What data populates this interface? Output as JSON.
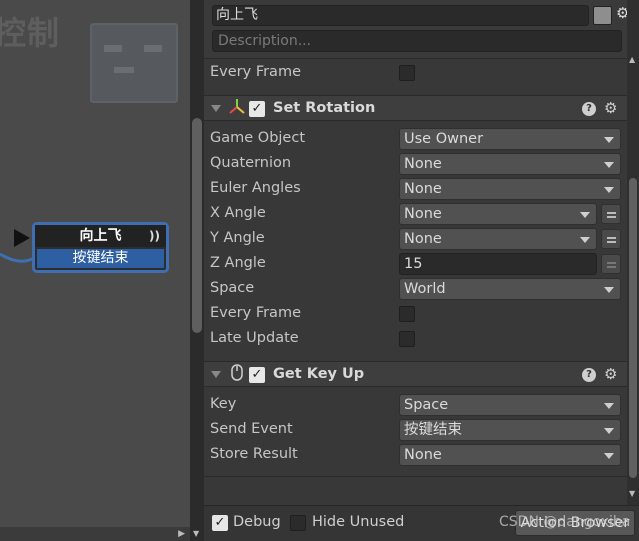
{
  "graph": {
    "title": "控制",
    "node": {
      "name": "向上飞",
      "event": "按键结束"
    }
  },
  "inspector": {
    "state_name": "向上飞",
    "description_placeholder": "Description...",
    "prev_action_rows": [
      {
        "label": "Every Frame"
      }
    ],
    "set_rotation": {
      "title": "Set Rotation",
      "enabled": true,
      "rows": {
        "game_object": {
          "label": "Game Object",
          "value": "Use Owner"
        },
        "quaternion": {
          "label": "Quaternion",
          "value": "None"
        },
        "euler_angles": {
          "label": "Euler Angles",
          "value": "None"
        },
        "x_angle": {
          "label": "X Angle",
          "value": "None"
        },
        "y_angle": {
          "label": "Y Angle",
          "value": "None"
        },
        "z_angle": {
          "label": "Z Angle",
          "value": "15"
        },
        "space": {
          "label": "Space",
          "value": "World"
        },
        "every_frame": {
          "label": "Every Frame"
        },
        "late_update": {
          "label": "Late Update"
        }
      }
    },
    "get_key_up": {
      "title": "Get Key Up",
      "enabled": true,
      "rows": {
        "key": {
          "label": "Key",
          "value": "Space"
        },
        "send_event": {
          "label": "Send Event",
          "value": "按键结束"
        },
        "store_result": {
          "label": "Store Result",
          "value": "None"
        }
      }
    }
  },
  "bottom_bar": {
    "debug_label": "Debug",
    "hide_unused_label": "Hide Unused",
    "action_browser_label": "Action Browser",
    "watermark": "CSDN @dangoxiba"
  },
  "colors": {
    "accent_node": "#3e6fb3",
    "event_blue": "#2f5fa3"
  }
}
